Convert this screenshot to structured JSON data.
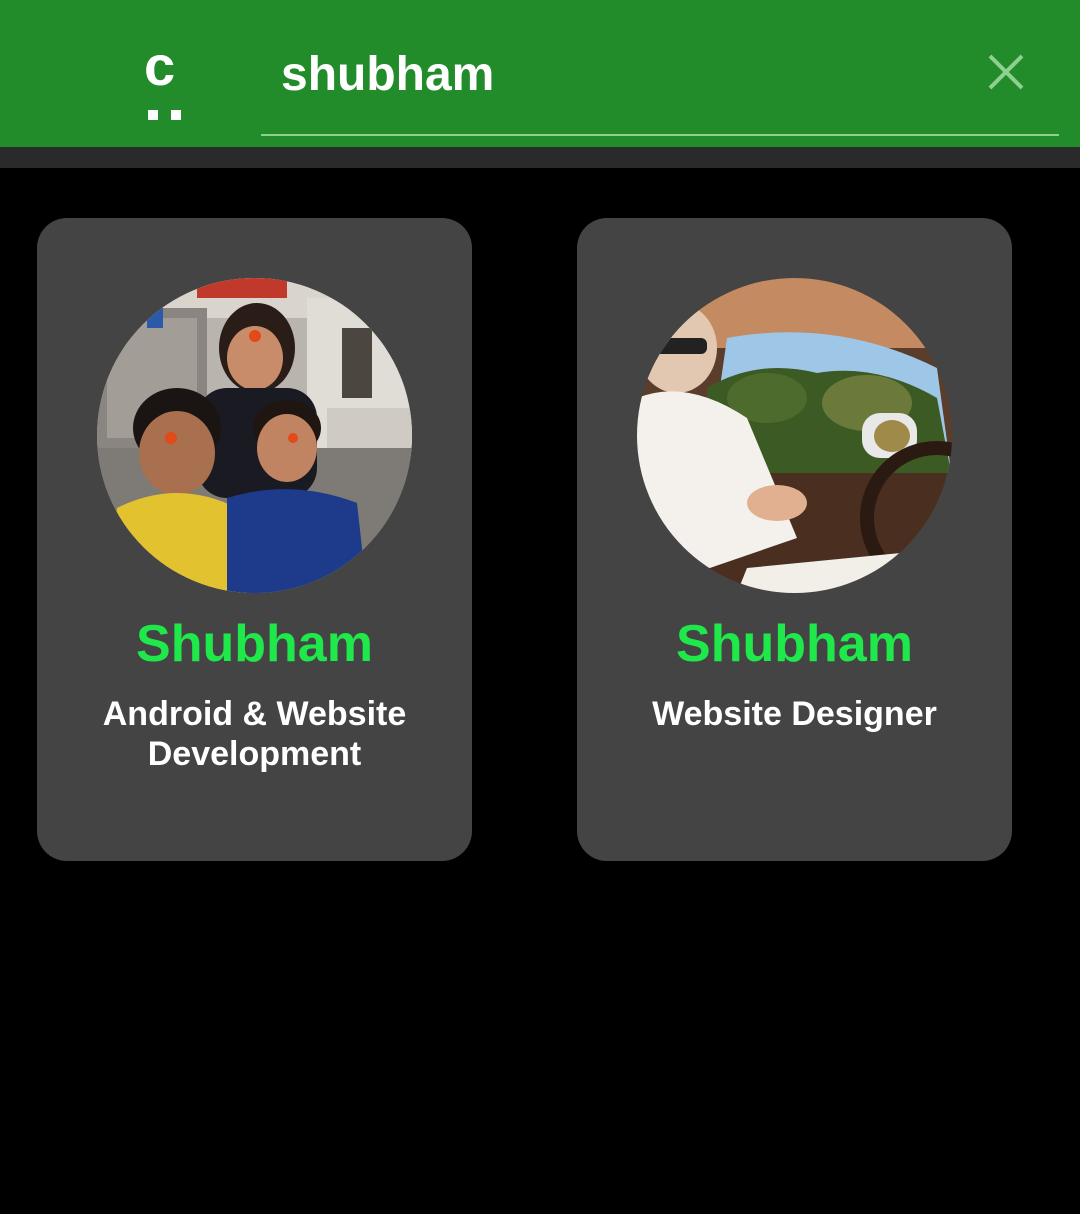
{
  "colors": {
    "appbar": "#228b2a",
    "background": "#000000",
    "card": "#444444",
    "name_accent": "#1ee84a",
    "text": "#ffffff"
  },
  "header": {
    "logo_letter": "c",
    "logo_icon": "app-logo-icon",
    "search_value": "shubham",
    "clear_icon": "close-icon"
  },
  "results": [
    {
      "name": "Shubham",
      "role": "Android & Website Development",
      "avatar_icon": "profile-photo"
    },
    {
      "name": "Shubham",
      "role": "Website Designer",
      "avatar_icon": "profile-photo"
    }
  ]
}
